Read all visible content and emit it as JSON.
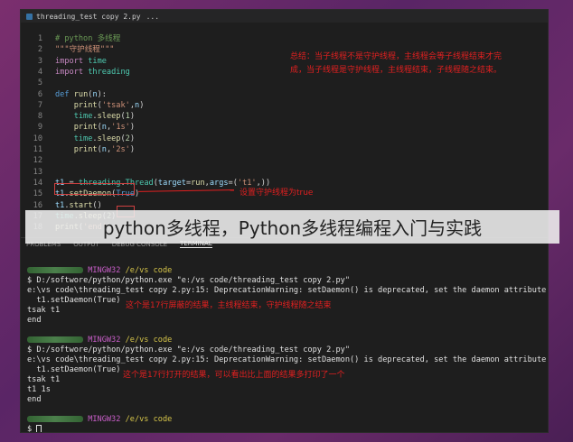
{
  "tab": {
    "title": "threading_test copy 2.py",
    "more": "..."
  },
  "editor_lines": [
    {
      "n": "1",
      "parts": [
        [
          "cmt",
          "# python 多线程"
        ]
      ]
    },
    {
      "n": "2",
      "parts": [
        [
          "str",
          "\"\"\"守护线程\"\"\""
        ]
      ]
    },
    {
      "n": "3",
      "parts": [
        [
          "kw",
          "import"
        ],
        [
          "",
          " "
        ],
        [
          "mod",
          "time"
        ]
      ]
    },
    {
      "n": "4",
      "parts": [
        [
          "kw",
          "import"
        ],
        [
          "",
          " "
        ],
        [
          "mod",
          "threading"
        ]
      ]
    },
    {
      "n": "5",
      "parts": []
    },
    {
      "n": "6",
      "parts": [
        [
          "kw2",
          "def"
        ],
        [
          "",
          " "
        ],
        [
          "fn",
          "run"
        ],
        [
          "",
          "("
        ],
        [
          "var",
          "n"
        ],
        [
          "",
          "):"
        ]
      ]
    },
    {
      "n": "7",
      "parts": [
        [
          "",
          "    "
        ],
        [
          "fn",
          "print"
        ],
        [
          "",
          "("
        ],
        [
          "str",
          "'tsak'"
        ],
        [
          "",
          ","
        ],
        [
          "var",
          "n"
        ],
        [
          "",
          ")"
        ]
      ]
    },
    {
      "n": "8",
      "parts": [
        [
          "",
          "    "
        ],
        [
          "mod",
          "time"
        ],
        [
          "",
          "."
        ],
        [
          "fn",
          "sleep"
        ],
        [
          "",
          "("
        ],
        [
          "num",
          "1"
        ],
        [
          "",
          ")"
        ]
      ]
    },
    {
      "n": "9",
      "parts": [
        [
          "",
          "    "
        ],
        [
          "fn",
          "print"
        ],
        [
          "",
          "("
        ],
        [
          "var",
          "n"
        ],
        [
          "",
          ","
        ],
        [
          "str",
          "'1s'"
        ],
        [
          "",
          ")"
        ]
      ]
    },
    {
      "n": "10",
      "parts": [
        [
          "",
          "    "
        ],
        [
          "mod",
          "time"
        ],
        [
          "",
          "."
        ],
        [
          "fn",
          "sleep"
        ],
        [
          "",
          "("
        ],
        [
          "num",
          "2"
        ],
        [
          "",
          ")"
        ]
      ]
    },
    {
      "n": "11",
      "parts": [
        [
          "",
          "    "
        ],
        [
          "fn",
          "print"
        ],
        [
          "",
          "("
        ],
        [
          "var",
          "n"
        ],
        [
          "",
          ","
        ],
        [
          "str",
          "'2s'"
        ],
        [
          "",
          ")"
        ]
      ]
    },
    {
      "n": "12",
      "parts": []
    },
    {
      "n": "13",
      "parts": []
    },
    {
      "n": "14",
      "parts": [
        [
          "var",
          "t1"
        ],
        [
          "",
          " = "
        ],
        [
          "mod",
          "threading"
        ],
        [
          "",
          "."
        ],
        [
          "mod",
          "Thread"
        ],
        [
          "",
          "("
        ],
        [
          "var",
          "target"
        ],
        [
          "",
          "="
        ],
        [
          "fn",
          "run"
        ],
        [
          "",
          ","
        ],
        [
          "var",
          "args"
        ],
        [
          "",
          "=("
        ],
        [
          "str",
          "'t1'"
        ],
        [
          "",
          ",))"
        ]
      ]
    },
    {
      "n": "15",
      "parts": [
        [
          "var",
          "t1"
        ],
        [
          "",
          "."
        ],
        [
          "fn",
          "setDaemon"
        ],
        [
          "",
          "("
        ],
        [
          "kw2",
          "True"
        ],
        [
          "",
          ")"
        ]
      ]
    },
    {
      "n": "16",
      "parts": [
        [
          "var",
          "t1"
        ],
        [
          "",
          "."
        ],
        [
          "fn",
          "start"
        ],
        [
          "",
          "()"
        ]
      ]
    },
    {
      "n": "17",
      "parts": [
        [
          "mod",
          "time"
        ],
        [
          "",
          "."
        ],
        [
          "fn",
          "sleep"
        ],
        [
          "",
          "("
        ],
        [
          "num",
          "2"
        ],
        [
          "",
          ")"
        ]
      ]
    },
    {
      "n": "18",
      "parts": [
        [
          "fn",
          "print"
        ],
        [
          "",
          "("
        ],
        [
          "str",
          "'end'"
        ],
        [
          "",
          ")"
        ]
      ]
    }
  ],
  "notes": {
    "summary_1": "总结：当子线程不是守护线程，主线程会等子线程结束才完",
    "summary_2": "成，当子线程是守护线程，主线程结束，子线程随之结束。",
    "daemon_note": "设置守护线程为true",
    "run1_note": "这个是17行屏蔽的结果，主线程结束，守护线程随之结束",
    "run2_note": "这个是17行打开的结果，可以看出比上面的结果多打印了一个"
  },
  "panel_tabs": [
    "PROBLEMS",
    "OUTPUT",
    "DEBUG CONSOLE",
    "TERMINAL"
  ],
  "terminal": {
    "prompt_host": "MINGW32",
    "prompt_path": "/e/vs code",
    "cmd": "$ D:/softwore/python/python.exe \"e:/vs code/threading_test copy 2.py\"",
    "warn_1": "e:\\vs code\\threading_test copy 2.py:15: DeprecationWarning: setDaemon() is deprecated, set the daemon attribute instead",
    "warn_2": "  t1.setDaemon(True)",
    "run1_out": [
      "tsak t1",
      "end"
    ],
    "run2_out": [
      "tsak t1",
      "t1 1s",
      "end"
    ],
    "final_prompt": "$ "
  },
  "overlay_title": "python多线程，Python多线程编程入门与实践"
}
